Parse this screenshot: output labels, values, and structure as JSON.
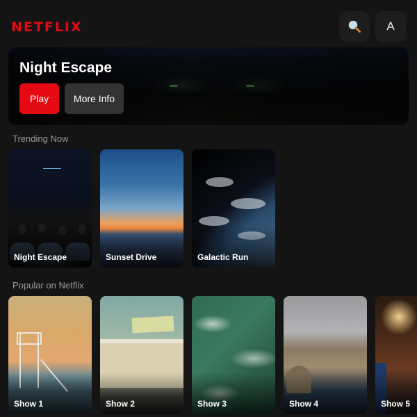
{
  "app": {
    "logo": "NETFLIX",
    "brand_color": "#e50914"
  },
  "header": {
    "search_icon": "search-icon",
    "profile_initial": "A"
  },
  "hero": {
    "title": "Night Escape",
    "play_label": "Play",
    "info_label": "More Info"
  },
  "rows": [
    {
      "title": "Trending Now",
      "items": [
        {
          "label": "Night Escape"
        },
        {
          "label": "Sunset Drive"
        },
        {
          "label": "Galactic Run"
        }
      ]
    },
    {
      "title": "Popular on Netflix",
      "items": [
        {
          "label": "Show 1"
        },
        {
          "label": "Show 2"
        },
        {
          "label": "Show 3"
        },
        {
          "label": "Show 4"
        },
        {
          "label": "Show 5"
        }
      ]
    }
  ]
}
